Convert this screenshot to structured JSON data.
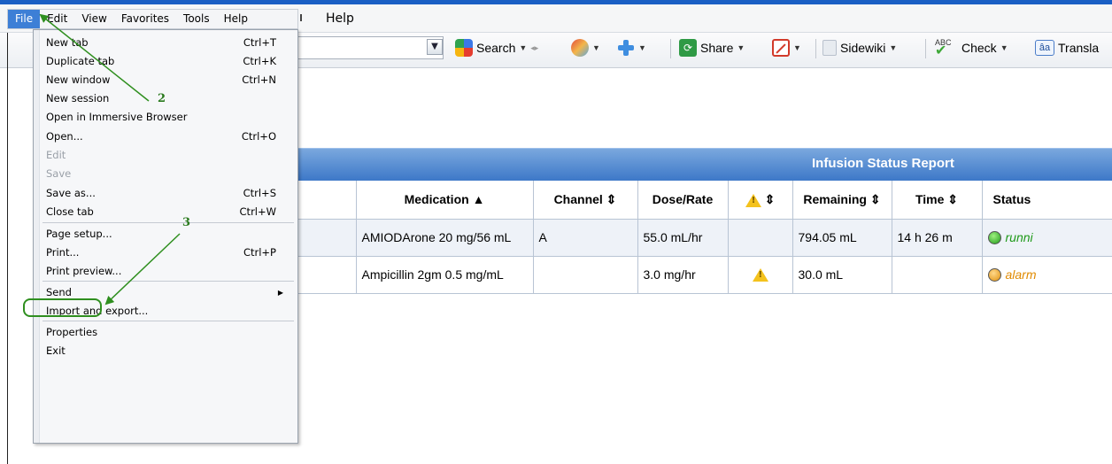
{
  "menubar": {
    "items": [
      "File",
      "Edit",
      "View",
      "Favorites",
      "Tools",
      "Help"
    ],
    "active_index": 0,
    "behind_help": "Help"
  },
  "toolbar": {
    "search_label": "Search",
    "share_label": "Share",
    "sidewiki_label": "Sidewiki",
    "check_label": "Check",
    "check_icon_text": "ABC",
    "translate_label": "Transla",
    "translate_icon_text": "âa"
  },
  "file_menu": {
    "items": [
      {
        "label": "New tab",
        "shortcut": "Ctrl+T",
        "enabled": true
      },
      {
        "label": "Duplicate tab",
        "shortcut": "Ctrl+K",
        "enabled": true
      },
      {
        "label": "New window",
        "shortcut": "Ctrl+N",
        "enabled": true
      },
      {
        "label": "New session",
        "shortcut": "",
        "enabled": true
      },
      {
        "label": "Open in Immersive Browser",
        "shortcut": "",
        "enabled": true
      },
      {
        "label": "Open...",
        "shortcut": "Ctrl+O",
        "enabled": true
      },
      {
        "label": "Edit",
        "shortcut": "",
        "enabled": false
      },
      {
        "label": "Save",
        "shortcut": "",
        "enabled": false
      },
      {
        "label": "Save as...",
        "shortcut": "Ctrl+S",
        "enabled": true
      },
      {
        "label": "Close tab",
        "shortcut": "Ctrl+W",
        "enabled": true
      },
      {
        "label": "Page setup...",
        "shortcut": "",
        "enabled": true
      },
      {
        "label": "Print...",
        "shortcut": "Ctrl+P",
        "enabled": true
      },
      {
        "label": "Print preview...",
        "shortcut": "",
        "enabled": true
      },
      {
        "label": "Send",
        "shortcut": "",
        "enabled": true
      },
      {
        "label": "Import and export...",
        "shortcut": "",
        "enabled": true
      },
      {
        "label": "Properties",
        "shortcut": "",
        "enabled": true
      },
      {
        "label": "Exit",
        "shortcut": "",
        "enabled": true
      }
    ]
  },
  "callouts": {
    "step2": "2",
    "step3": "3"
  },
  "report": {
    "title": "Infusion Status Report",
    "columns": [
      "Medication ▲",
      "Channel ⇕",
      "Dose/Rate",
      "⇕",
      "Remaining ⇕",
      "Time ⇕",
      "Status"
    ],
    "rows": [
      {
        "medication": "AMIODArone 20 mg/56 mL",
        "channel": "A",
        "dose_rate": "55.0 mL/hr",
        "alert": "",
        "remaining": "794.05 mL",
        "time": "14 h 26 m",
        "status": "runni"
      },
      {
        "medication": "Ampicillin 2gm 0.5 mg/mL",
        "channel": "",
        "dose_rate": "3.0 mg/hr",
        "alert": "warning",
        "remaining": "30.0 mL",
        "time": "",
        "status": "alarm"
      }
    ]
  },
  "colors": {
    "accent": "#3d7fd6",
    "report_header": "#3d78c8",
    "annotation": "#2f8f1f",
    "running": "#1f9a1a",
    "alarm": "#e08a00"
  }
}
